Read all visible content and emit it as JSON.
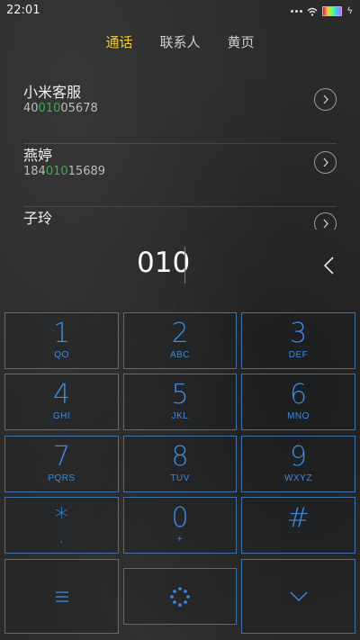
{
  "status_bar": {
    "time": "22:01"
  },
  "tabs": [
    {
      "label": "通话",
      "active": true
    },
    {
      "label": "联系人",
      "active": false
    },
    {
      "label": "黄页",
      "active": false
    }
  ],
  "contacts": [
    {
      "name": "小米客服",
      "number_pre": "40",
      "number_match": "010",
      "number_post": "05678"
    },
    {
      "name": "燕婷",
      "number_pre": "184",
      "number_match": "010",
      "number_post": "15689"
    },
    {
      "name": "子玲",
      "number_pre": "",
      "number_match": "",
      "number_post": ""
    }
  ],
  "dial_input": {
    "digits": "010"
  },
  "keypad": {
    "keys": [
      {
        "num": "1",
        "sub": "QO"
      },
      {
        "num": "2",
        "sub": "ABC"
      },
      {
        "num": "3",
        "sub": "DEF"
      },
      {
        "num": "4",
        "sub": "GHI"
      },
      {
        "num": "5",
        "sub": "JKL"
      },
      {
        "num": "6",
        "sub": "MNO"
      },
      {
        "num": "7",
        "sub": "PQRS"
      },
      {
        "num": "8",
        "sub": "TUV"
      },
      {
        "num": "9",
        "sub": "WXYZ"
      },
      {
        "num": "*",
        "sub": ","
      },
      {
        "num": "0",
        "sub": "+"
      },
      {
        "num": "#",
        "sub": ""
      }
    ]
  },
  "colors": {
    "accent_tab": "#f0cc2b",
    "key_blue": "#3d8ae0",
    "match_green": "#3cb043"
  }
}
